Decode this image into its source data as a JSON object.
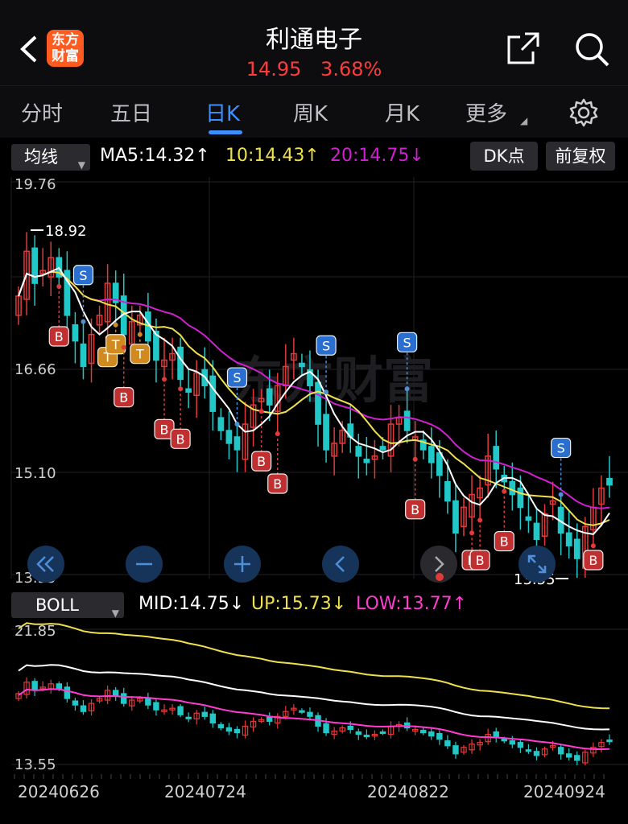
{
  "header": {
    "back_icon": "chevron-left-icon",
    "logo": [
      "东方",
      "财富"
    ],
    "title": "利通电子",
    "price": "14.95",
    "change_pct": "3.68%",
    "colors": {
      "up": "#ff3b3b",
      "bg": "#0d0d0f"
    }
  },
  "tabs": {
    "items": [
      "分时",
      "五日",
      "日K",
      "周K",
      "月K",
      "更多"
    ],
    "active": "日K"
  },
  "indicator": {
    "select": "均线",
    "ma5": "MA5:14.32",
    "ma10": "10:14.43",
    "ma20": "20:14.75",
    "dk_label": "DK点",
    "fq_label": "前复权"
  },
  "main_axis": {
    "top": "19.76",
    "mid": "16.66",
    "low": "15.10",
    "bottom": "13.55",
    "max_mark": "18.92",
    "min_mark": "13.55"
  },
  "boll": {
    "select": "BOLL",
    "mid": "MID:14.75",
    "up": "UP:15.73",
    "low": "LOW:13.77",
    "axis_top": "21.85",
    "axis_bottom": "13.55"
  },
  "dates": [
    "20240626",
    "20240724",
    "20240822",
    "20240924"
  ],
  "watermark": "东方财富",
  "controls": [
    "double-chevron-left-icon",
    "zoom-out-icon",
    "zoom-in-icon",
    "chevron-left-icon",
    "chevron-right-icon",
    "fullscreen-icon"
  ],
  "signals": {
    "buy": "B",
    "sell": "S",
    "t": "T"
  },
  "chart_data": {
    "type": "candlestick",
    "colors": {
      "up": "#e23a3a",
      "down": "#22c8c8",
      "ma5": "#ffffff",
      "ma10": "#f0e050",
      "ma20": "#d020d0"
    },
    "close": [
      17.9,
      18.6,
      18.1,
      18.3,
      18.5,
      18.2,
      17.6,
      17.2,
      16.8,
      17.3,
      17.6,
      18.1,
      17.8,
      17.3,
      17.5,
      17.6,
      17.2,
      16.9,
      16.9,
      17.0,
      16.6,
      16.4,
      16.7,
      16.5,
      16.1,
      15.8,
      15.6,
      15.5,
      15.9,
      16.2,
      16.3,
      16.2,
      16.5,
      16.8,
      17.0,
      16.8,
      16.5,
      15.9,
      15.5,
      15.6,
      15.8,
      15.7,
      15.4,
      15.3,
      15.4,
      15.5,
      15.9,
      16.0,
      15.8,
      15.7,
      15.5,
      15.3,
      15.1,
      14.7,
      14.2,
      14.6,
      14.8,
      14.9,
      15.4,
      15.2,
      15.0,
      14.8,
      14.6,
      14.4,
      14.1,
      14.5,
      14.7,
      14.2,
      14.0,
      13.8,
      14.3,
      14.6,
      14.9,
      14.95
    ],
    "signals": [
      {
        "i": 5,
        "label": "B"
      },
      {
        "i": 8,
        "label": "S"
      },
      {
        "i": 11,
        "label": "T"
      },
      {
        "i": 12,
        "label": "T"
      },
      {
        "i": 13,
        "label": "B"
      },
      {
        "i": 15,
        "label": "T"
      },
      {
        "i": 18,
        "label": "B"
      },
      {
        "i": 20,
        "label": "B"
      },
      {
        "i": 27,
        "label": "S"
      },
      {
        "i": 30,
        "label": "B"
      },
      {
        "i": 32,
        "label": "B"
      },
      {
        "i": 38,
        "label": "S"
      },
      {
        "i": 48,
        "label": "S"
      },
      {
        "i": 49,
        "label": "B"
      },
      {
        "i": 56,
        "label": "B"
      },
      {
        "i": 57,
        "label": "B"
      },
      {
        "i": 60,
        "label": "B"
      },
      {
        "i": 67,
        "label": "S"
      },
      {
        "i": 71,
        "label": "B"
      }
    ]
  }
}
